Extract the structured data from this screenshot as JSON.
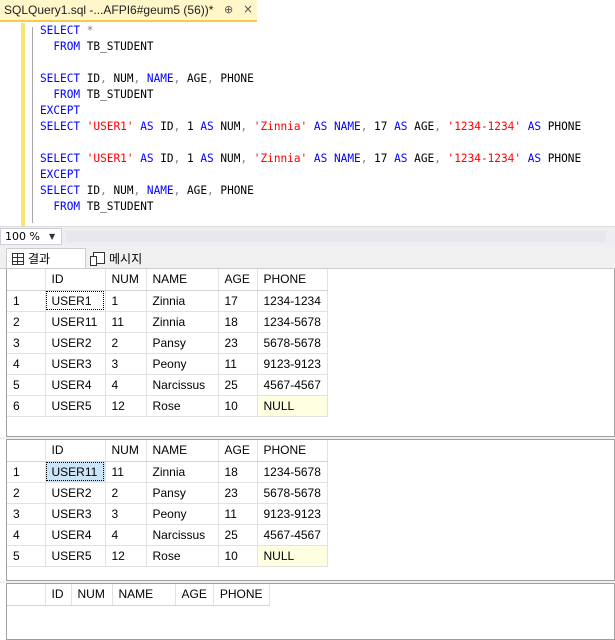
{
  "tab": {
    "title": "SQLQuery1.sql -...AFPI6#geum5 (56))*",
    "pin": "⊕",
    "close": "×"
  },
  "editor": {
    "lines": [
      [
        {
          "t": "SELECT",
          "c": "kw"
        },
        {
          "t": " *",
          "c": "gr"
        }
      ],
      [
        {
          "t": "  FROM",
          "c": "kw"
        },
        {
          "t": " TB_STUDENT",
          "c": "pl"
        }
      ],
      [],
      [
        {
          "t": "SELECT",
          "c": "kw"
        },
        {
          "t": " ID",
          "c": "pl"
        },
        {
          "t": ",",
          "c": "gr"
        },
        {
          "t": " NUM",
          "c": "pl"
        },
        {
          "t": ",",
          "c": "gr"
        },
        {
          "t": " NAME",
          "c": "kw"
        },
        {
          "t": ",",
          "c": "gr"
        },
        {
          "t": " AGE",
          "c": "pl"
        },
        {
          "t": ",",
          "c": "gr"
        },
        {
          "t": " PHONE",
          "c": "pl"
        }
      ],
      [
        {
          "t": "  FROM",
          "c": "kw"
        },
        {
          "t": " TB_STUDENT",
          "c": "pl"
        }
      ],
      [
        {
          "t": "EXCEPT",
          "c": "kw"
        }
      ],
      [
        {
          "t": "SELECT",
          "c": "kw"
        },
        {
          "t": " 'USER1'",
          "c": "str"
        },
        {
          "t": " AS",
          "c": "kw"
        },
        {
          "t": " ID",
          "c": "pl"
        },
        {
          "t": ",",
          "c": "gr"
        },
        {
          "t": " 1",
          "c": "pl"
        },
        {
          "t": " AS",
          "c": "kw"
        },
        {
          "t": " NUM",
          "c": "pl"
        },
        {
          "t": ",",
          "c": "gr"
        },
        {
          "t": " 'Zinnia'",
          "c": "str"
        },
        {
          "t": " AS",
          "c": "kw"
        },
        {
          "t": " NAME",
          "c": "kw"
        },
        {
          "t": ",",
          "c": "gr"
        },
        {
          "t": " 17",
          "c": "pl"
        },
        {
          "t": " AS",
          "c": "kw"
        },
        {
          "t": " AGE",
          "c": "pl"
        },
        {
          "t": ",",
          "c": "gr"
        },
        {
          "t": " '1234-1234'",
          "c": "str"
        },
        {
          "t": " AS",
          "c": "kw"
        },
        {
          "t": " PHONE",
          "c": "pl"
        }
      ],
      [],
      [
        {
          "t": "SELECT",
          "c": "kw"
        },
        {
          "t": " 'USER1'",
          "c": "str"
        },
        {
          "t": " AS",
          "c": "kw"
        },
        {
          "t": " ID",
          "c": "pl"
        },
        {
          "t": ",",
          "c": "gr"
        },
        {
          "t": " 1",
          "c": "pl"
        },
        {
          "t": " AS",
          "c": "kw"
        },
        {
          "t": " NUM",
          "c": "pl"
        },
        {
          "t": ",",
          "c": "gr"
        },
        {
          "t": " 'Zinnia'",
          "c": "str"
        },
        {
          "t": " AS",
          "c": "kw"
        },
        {
          "t": " NAME",
          "c": "kw"
        },
        {
          "t": ",",
          "c": "gr"
        },
        {
          "t": " 17",
          "c": "pl"
        },
        {
          "t": " AS",
          "c": "kw"
        },
        {
          "t": " AGE",
          "c": "pl"
        },
        {
          "t": ",",
          "c": "gr"
        },
        {
          "t": " '1234-1234'",
          "c": "str"
        },
        {
          "t": " AS",
          "c": "kw"
        },
        {
          "t": " PHONE",
          "c": "pl"
        }
      ],
      [
        {
          "t": "EXCEPT",
          "c": "kw"
        }
      ],
      [
        {
          "t": "SELECT",
          "c": "kw"
        },
        {
          "t": " ID",
          "c": "pl"
        },
        {
          "t": ",",
          "c": "gr"
        },
        {
          "t": " NUM",
          "c": "pl"
        },
        {
          "t": ",",
          "c": "gr"
        },
        {
          "t": " NAME",
          "c": "kw"
        },
        {
          "t": ",",
          "c": "gr"
        },
        {
          "t": " AGE",
          "c": "pl"
        },
        {
          "t": ",",
          "c": "gr"
        },
        {
          "t": " PHONE",
          "c": "pl"
        }
      ],
      [
        {
          "t": "  FROM",
          "c": "kw"
        },
        {
          "t": " TB_STUDENT",
          "c": "pl"
        }
      ]
    ]
  },
  "status": {
    "zoom": "100 %"
  },
  "result_tabs": {
    "results": "결과",
    "messages": "메시지"
  },
  "columns": [
    "ID",
    "NUM",
    "NAME",
    "AGE",
    "PHONE"
  ],
  "grid1": [
    [
      "1",
      "USER1",
      "1",
      "Zinnia",
      "17",
      "1234-1234"
    ],
    [
      "2",
      "USER11",
      "11",
      "Zinnia",
      "18",
      "1234-5678"
    ],
    [
      "3",
      "USER2",
      "2",
      "Pansy",
      "23",
      "5678-5678"
    ],
    [
      "4",
      "USER3",
      "3",
      "Peony",
      "11",
      "9123-9123"
    ],
    [
      "5",
      "USER4",
      "4",
      "Narcissus",
      "25",
      "4567-4567"
    ],
    [
      "6",
      "USER5",
      "12",
      "Rose",
      "10",
      "NULL"
    ]
  ],
  "grid2": [
    [
      "1",
      "USER11",
      "11",
      "Zinnia",
      "18",
      "1234-5678"
    ],
    [
      "2",
      "USER2",
      "2",
      "Pansy",
      "23",
      "5678-5678"
    ],
    [
      "3",
      "USER3",
      "3",
      "Peony",
      "11",
      "9123-9123"
    ],
    [
      "4",
      "USER4",
      "4",
      "Narcissus",
      "25",
      "4567-4567"
    ],
    [
      "5",
      "USER5",
      "12",
      "Rose",
      "10",
      "NULL"
    ]
  ]
}
